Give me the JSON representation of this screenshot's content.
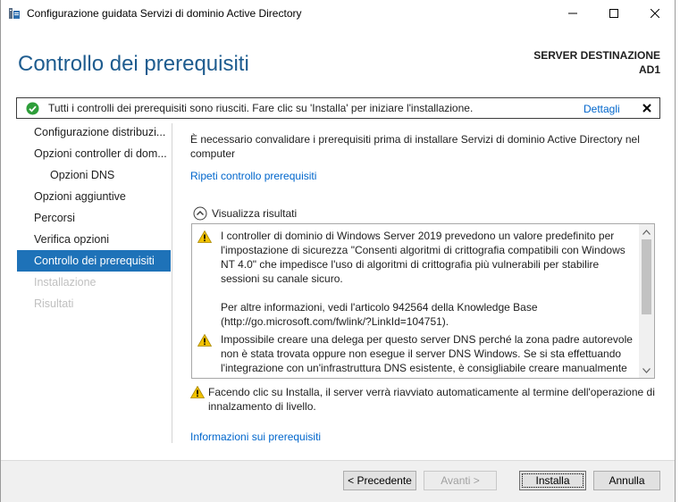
{
  "window": {
    "title": "Configurazione guidata Servizi di dominio Active Directory"
  },
  "header": {
    "page_title": "Controllo dei prerequisiti",
    "destination_label": "SERVER DESTINAZIONE",
    "destination_value": "AD1"
  },
  "notice": {
    "text": "Tutti i controlli dei prerequisiti sono riusciti. Fare clic su 'Installa' per iniziare l'installazione.",
    "details_link": "Dettagli",
    "status_color": "#2e9e3a"
  },
  "sidebar": {
    "items": [
      {
        "label": "Configurazione distribuzi...",
        "state": "normal"
      },
      {
        "label": "Opzioni controller di dom...",
        "state": "normal"
      },
      {
        "label": "Opzioni DNS",
        "state": "normal"
      },
      {
        "label": "Opzioni aggiuntive",
        "state": "normal"
      },
      {
        "label": "Percorsi",
        "state": "normal"
      },
      {
        "label": "Verifica opzioni",
        "state": "normal"
      },
      {
        "label": "Controllo dei prerequisiti",
        "state": "active"
      },
      {
        "label": "Installazione",
        "state": "disabled"
      },
      {
        "label": "Risultati",
        "state": "disabled"
      }
    ],
    "active_color": "#1e72b8"
  },
  "content": {
    "intro": "È necessario convalidare i prerequisiti prima di installare Servizi di dominio Active Directory nel computer",
    "recheck_link": "Ripeti controllo prerequisiti",
    "results_toggle": "Visualizza risultati",
    "results": [
      {
        "icon": "warning-icon",
        "text": "I controller di dominio di Windows Server 2019 prevedono un valore predefinito per l'impostazione di sicurezza \"Consenti algoritmi di crittografia compatibili con Windows NT 4.0\" che impedisce l'uso di algoritmi di crittografia più vulnerabili per stabilire sessioni su canale sicuro."
      },
      {
        "icon": "none",
        "text": "Per altre informazioni, vedi l'articolo 942564 della Knowledge Base (http://go.microsoft.com/fwlink/?LinkId=104751)."
      },
      {
        "icon": "warning-icon",
        "text": "Impossibile creare una delega per questo server DNS perché la zona padre autorevole non è stata trovata oppure non esegue il server DNS Windows. Se si sta effettuando l'integrazione con un'infrastruttura DNS esistente, è consigliabile creare manualmente una delega per questo server DNS nella zona padre per garantire una risoluzione dei nomi affidabile dall'esterno del dominio."
      }
    ],
    "reboot_warning": "Facendo clic su Installa, il server verrà riavviato automaticamente al termine dell'operazione di innalzamento di livello.",
    "more_info_link": "Informazioni sui prerequisiti",
    "link_color": "#0066cc",
    "title_color": "#1e5c8f",
    "warning_color": "#f2c200"
  },
  "footer": {
    "prev_label": "< Precedente",
    "next_label": "Avanti >",
    "install_label": "Installa",
    "cancel_label": "Annulla"
  }
}
